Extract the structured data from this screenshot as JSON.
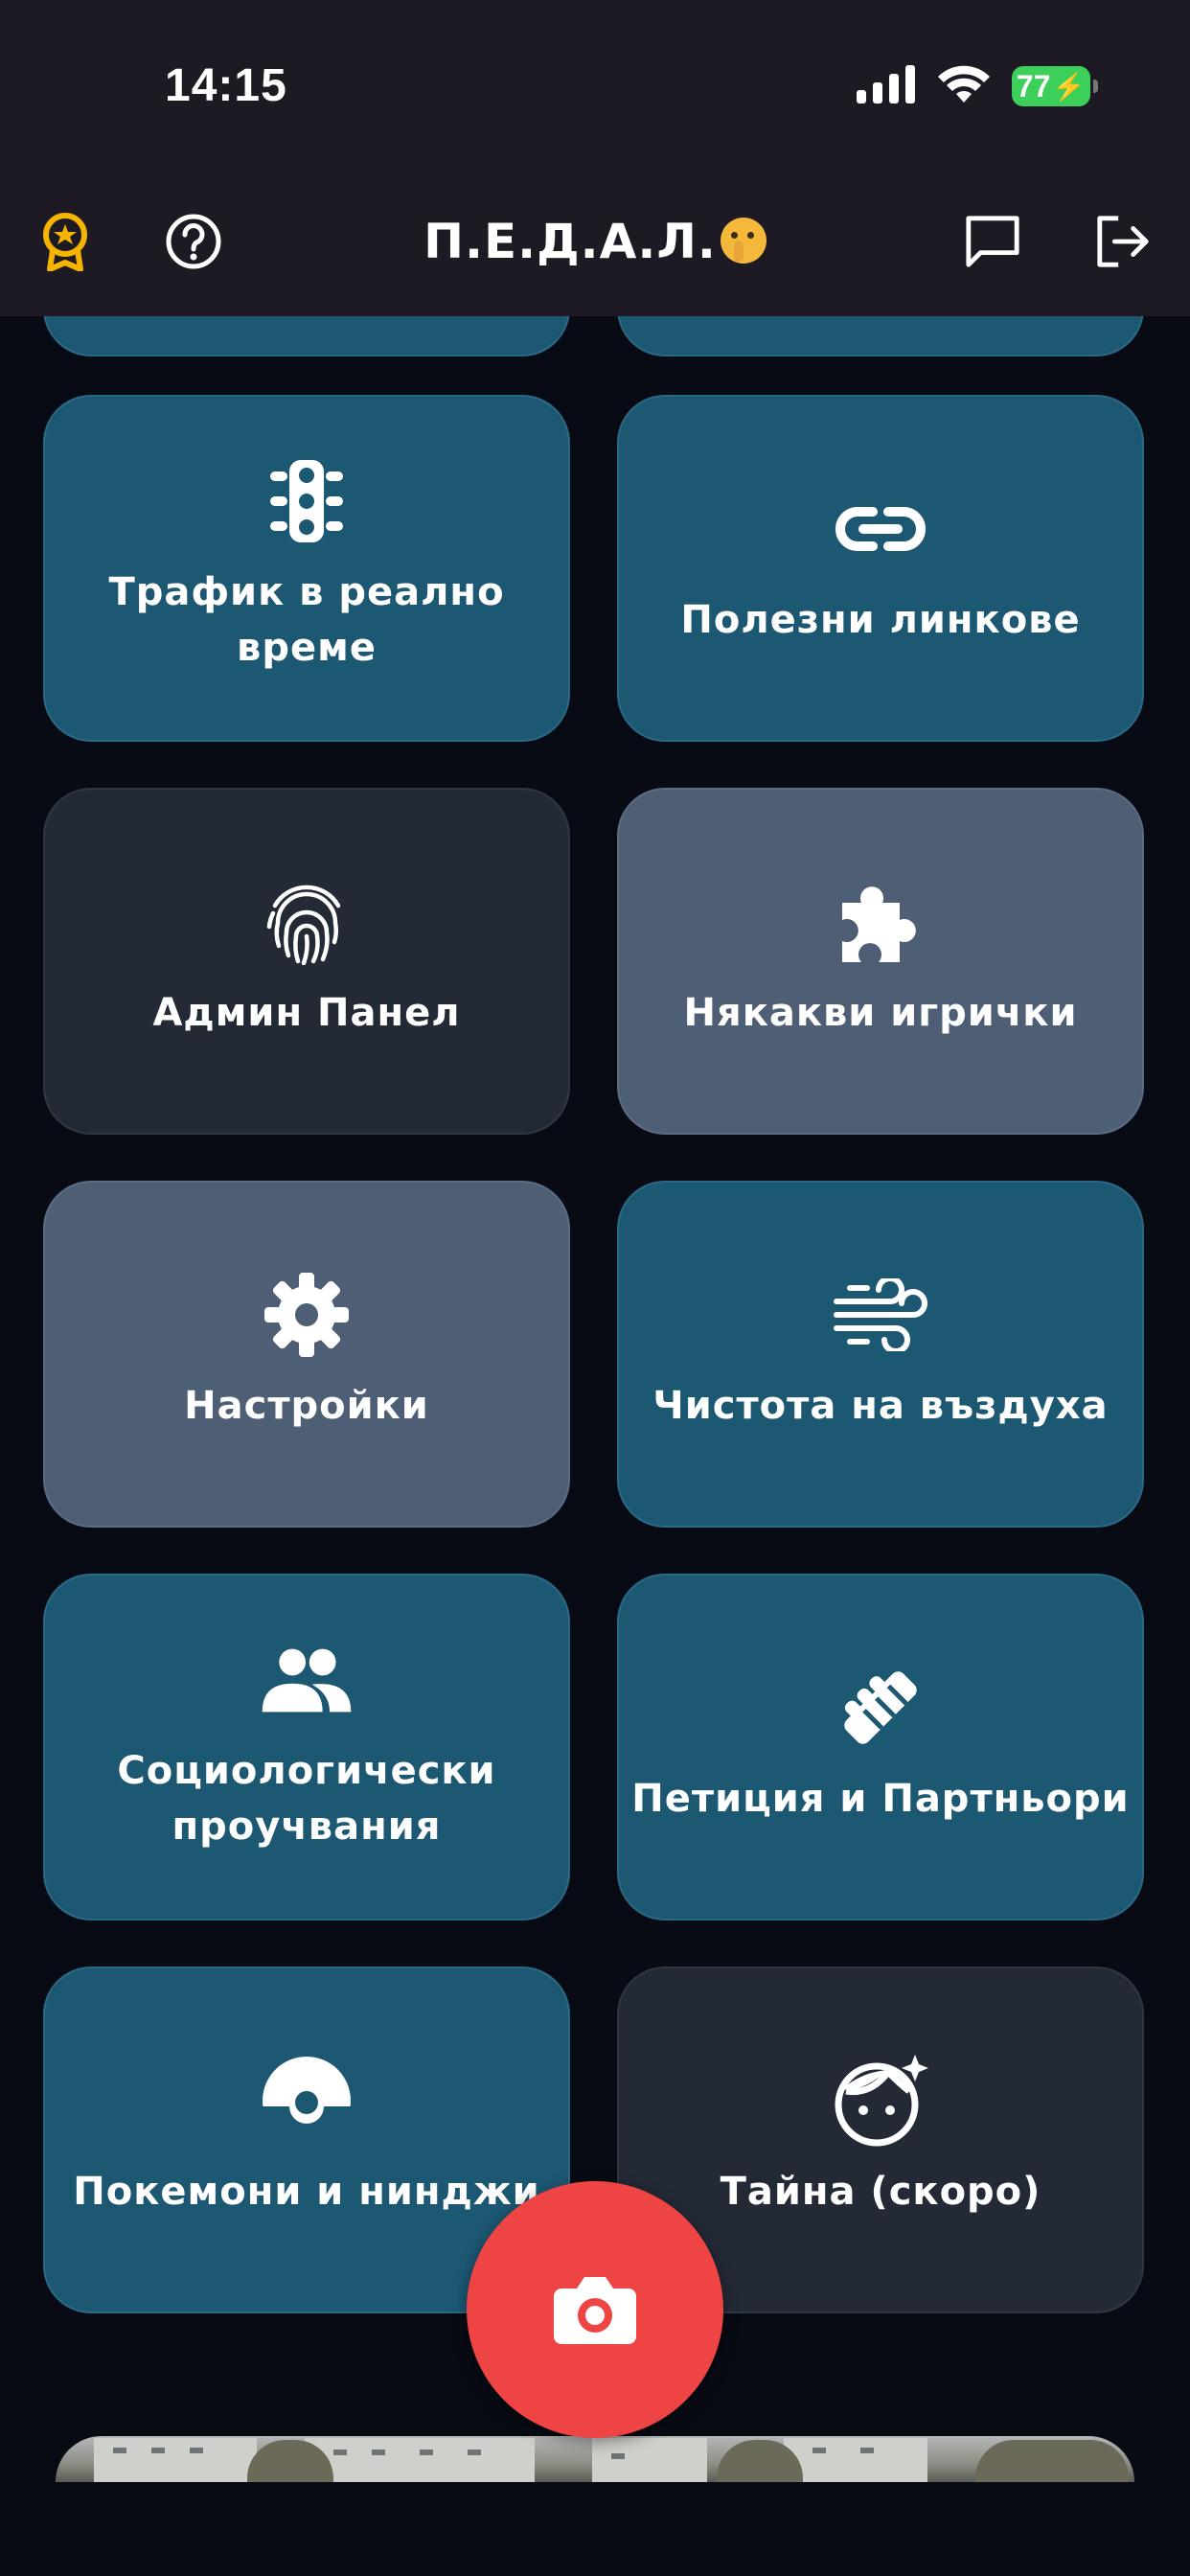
{
  "status_bar": {
    "time": "14:15",
    "battery": "77"
  },
  "header": {
    "title": "П.Е.Д.А.Л.",
    "left_icons": [
      "award-badge-icon",
      "help-circle-icon"
    ],
    "right_icons": [
      "chat-icon",
      "logout-icon"
    ]
  },
  "tiles": [
    {
      "label": "Трафик в реално време",
      "icon": "traffic-light-icon",
      "color": "#1d5873"
    },
    {
      "label": "Полезни линкове",
      "icon": "link-icon",
      "color": "#1d5873"
    },
    {
      "label": "Админ Панел",
      "icon": "fingerprint-icon",
      "color": "#232a36"
    },
    {
      "label": "Някакви игрички",
      "icon": "puzzle-icon",
      "color": "#4d5e75"
    },
    {
      "label": "Настройки",
      "icon": "gear-icon",
      "color": "#4d5e75"
    },
    {
      "label": "Чистота на въздуха",
      "icon": "wind-icon",
      "color": "#1d5873"
    },
    {
      "label_line1": "Социологически",
      "label_line2": "проучвания",
      "icon": "people-icon",
      "color": "#1d5873"
    },
    {
      "label": "Петиция и Партньори",
      "icon": "handshake-icon",
      "color": "#1d5873"
    },
    {
      "label": "Покемони и нинджи",
      "icon": "pokeball-icon",
      "color": "#1d5873"
    },
    {
      "label": "Тайна (скоро)",
      "icon": "face-sparkle-icon",
      "color": "#232a36"
    }
  ],
  "fab": {
    "icon": "camera-icon",
    "color": "#ef4444"
  },
  "accent_color": "#f5b400"
}
